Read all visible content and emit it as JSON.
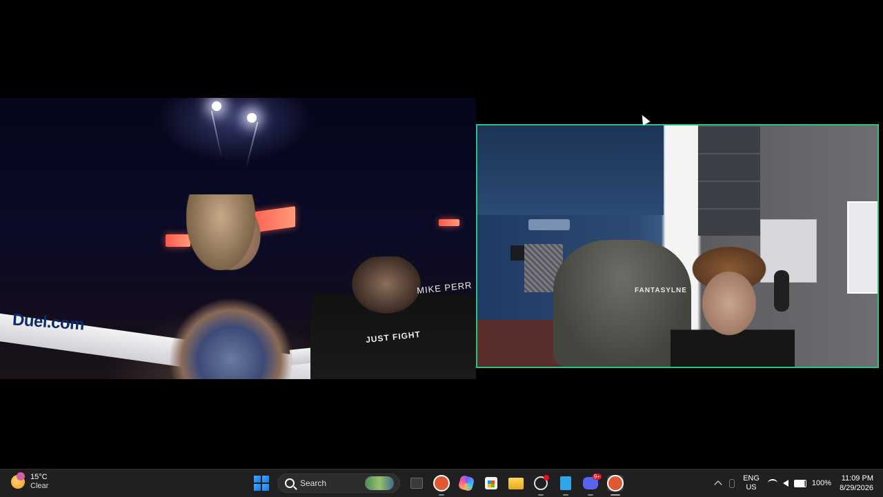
{
  "left_video": {
    "sponsor": "Duel.com",
    "cornerman_shirt": "JUST FIGHT",
    "banner_text": "MIKE PERR"
  },
  "right_video": {
    "chair_brand": "FANTASYLNE"
  },
  "taskbar": {
    "weather": {
      "temp": "15°C",
      "condition": "Clear"
    },
    "search": {
      "label": "Search"
    },
    "apps": [
      {
        "name": "File Explorer"
      },
      {
        "name": "DuckDuckGo"
      },
      {
        "name": "Copilot"
      },
      {
        "name": "Microsoft Store"
      },
      {
        "name": "Folder"
      },
      {
        "name": "OBS"
      },
      {
        "name": "Notepad"
      },
      {
        "name": "Discord",
        "badge": "9+"
      },
      {
        "name": "DuckDuckGo"
      }
    ],
    "tray": {
      "lang_top": "ENG",
      "lang_bottom": "US",
      "battery": "100%",
      "time": "11:09 PM",
      "date": "8/29/2026"
    }
  }
}
